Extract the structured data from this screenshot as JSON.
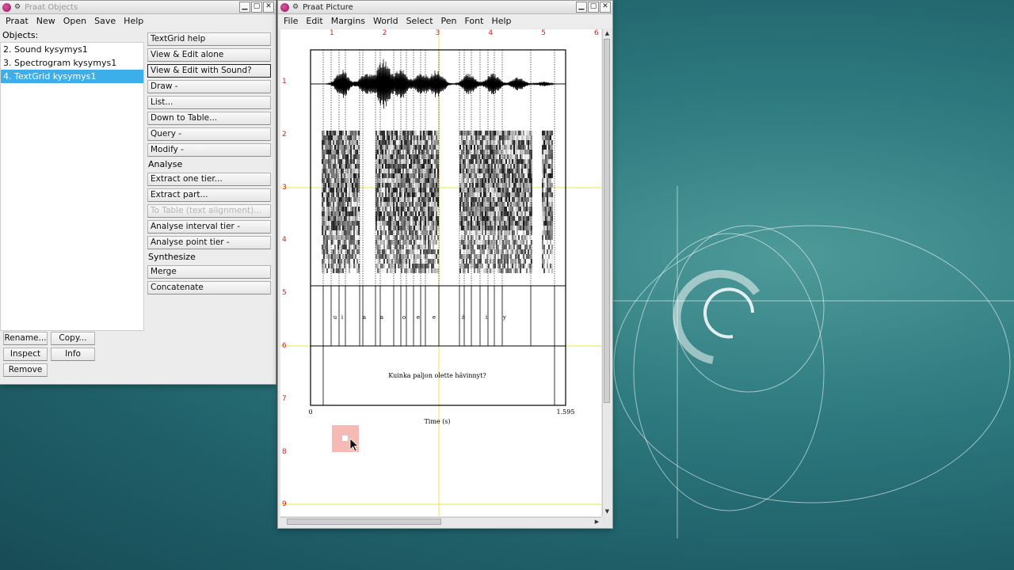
{
  "objects_window": {
    "title": "Praat Objects",
    "menu": [
      "Praat",
      "New",
      "Open",
      "Save",
      "Help"
    ],
    "objects_label": "Objects:",
    "items": [
      {
        "label": "2. Sound kysymys1",
        "selected": false
      },
      {
        "label": "3. Spectrogram kysymys1",
        "selected": false
      },
      {
        "label": "4. TextGrid kysymys1",
        "selected": true
      }
    ],
    "dynamic": [
      {
        "type": "button",
        "label": "TextGrid help"
      },
      {
        "type": "button",
        "label": "View & Edit alone"
      },
      {
        "type": "button",
        "label": "View & Edit with Sound?",
        "focused": true
      },
      {
        "type": "button",
        "label": "Draw -"
      },
      {
        "type": "button",
        "label": "List..."
      },
      {
        "type": "button",
        "label": "Down to Table..."
      },
      {
        "type": "button",
        "label": "Query -"
      },
      {
        "type": "button",
        "label": "Modify -"
      },
      {
        "type": "label",
        "label": "Analyse"
      },
      {
        "type": "button",
        "label": "Extract one tier..."
      },
      {
        "type": "button",
        "label": "Extract part..."
      },
      {
        "type": "button",
        "label": "To Table (text alignment)...",
        "disabled": true
      },
      {
        "type": "button",
        "label": "Analyse interval tier -"
      },
      {
        "type": "button",
        "label": "Analyse point tier -"
      },
      {
        "type": "label",
        "label": "Synthesize"
      },
      {
        "type": "button",
        "label": "Merge"
      },
      {
        "type": "button",
        "label": "Concatenate"
      }
    ],
    "bottom_buttons": {
      "rename": "Rename...",
      "copy": "Copy...",
      "inspect": "Inspect",
      "info": "Info",
      "remove": "Remove"
    }
  },
  "picture_window": {
    "title": "Praat Picture",
    "menu": [
      "File",
      "Edit",
      "Margins",
      "World",
      "Select",
      "Pen",
      "Font",
      "Help"
    ],
    "ruler_top": [
      "1",
      "2",
      "3",
      "4",
      "5",
      "6"
    ],
    "ruler_left": [
      "1",
      "2",
      "3",
      "4",
      "5",
      "6",
      "7",
      "8",
      "9"
    ],
    "figure": {
      "tier_labels": [
        "u",
        "i",
        "a",
        "a",
        "o",
        "e",
        "e",
        "ä",
        "i",
        "y"
      ],
      "sentence": "Kuinka paljon olette hävinnyt?",
      "x_axis_label": "Time (s)",
      "x_start": "0",
      "x_end": "1.595"
    }
  },
  "colors": {
    "selection": "#3daee9",
    "ruler": "#cc2222",
    "selection_guide": "#f2e14a",
    "cursor_box": "#f7b9b4"
  }
}
